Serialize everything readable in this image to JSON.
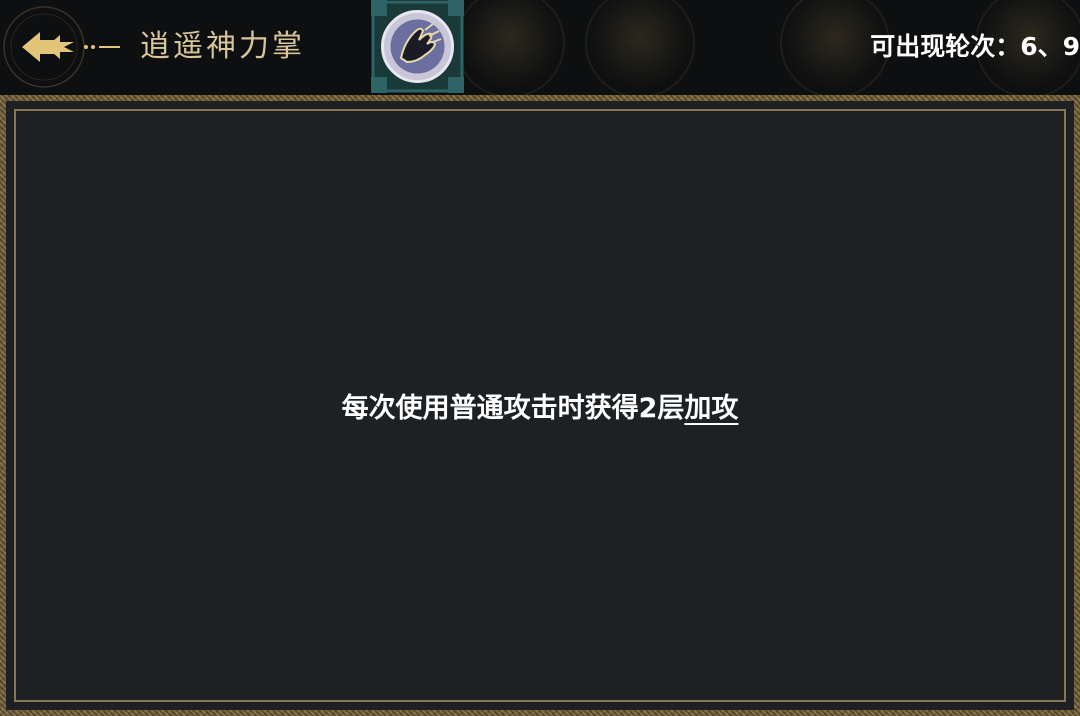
{
  "header": {
    "skill_name": "逍遥神力掌",
    "rounds_text": "可出现轮次：6、9"
  },
  "description": {
    "text_before": "每次使用普通攻击时获得2层",
    "keyword": "加攻"
  },
  "icons": {
    "back": "back-arrow-icon",
    "skill": "palm-strike-skill-icon"
  },
  "colors": {
    "title_gold": "#d8c59a",
    "panel_background": "#1d2124",
    "frame_gold": "#8a7650",
    "text_white": "#ffffff"
  }
}
